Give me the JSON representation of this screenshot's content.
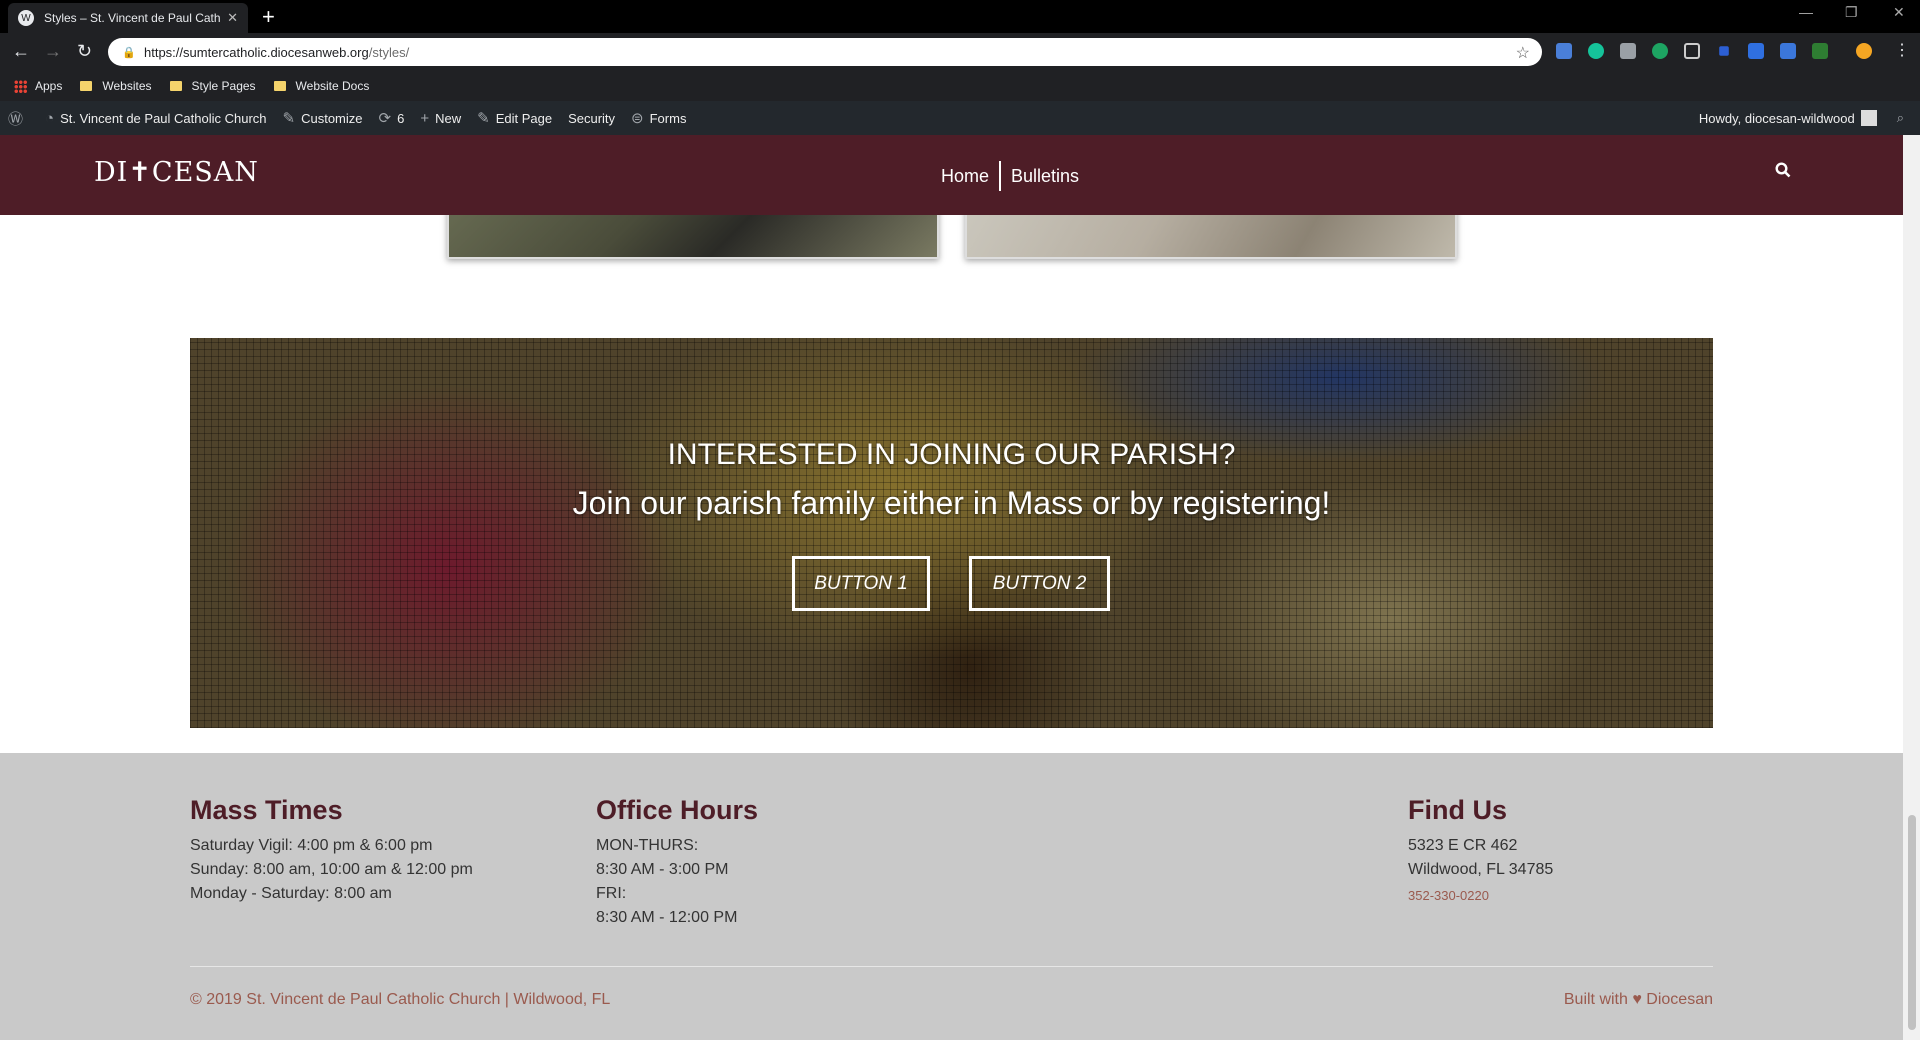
{
  "browser": {
    "tab_title": "Styles – St. Vincent de Paul Catho",
    "url_host": "https://sumtercatholic.diocesanweb.org",
    "url_path": "/styles/",
    "bookmarks": [
      "Apps",
      "Websites",
      "Style Pages",
      "Website Docs"
    ]
  },
  "adminbar": {
    "site_name": "St. Vincent de Paul Catholic Church",
    "customize": "Customize",
    "updates_count": "6",
    "new": "New",
    "edit_page": "Edit Page",
    "security": "Security",
    "forms": "Forms",
    "howdy": "Howdy, diocesan-wildwood"
  },
  "header": {
    "logo": "DI✝CESAN",
    "nav": [
      "Home",
      "Bulletins"
    ]
  },
  "cta": {
    "title": "INTERESTED IN JOINING OUR PARISH?",
    "subtitle": "Join our parish family either in Mass or by registering!",
    "button1": "BUTTON 1",
    "button2": "BUTTON 2"
  },
  "footer": {
    "mass": {
      "heading": "Mass Times",
      "lines": [
        "Saturday Vigil: 4:00 pm & 6:00 pm",
        "Sunday: 8:00 am, 10:00 am & 12:00 pm",
        "Monday - Saturday: 8:00 am"
      ]
    },
    "office": {
      "heading": "Office Hours",
      "lines": [
        "MON-THURS:",
        "8:30 AM - 3:00 PM",
        "FRI:",
        "8:30 AM - 12:00 PM"
      ]
    },
    "find": {
      "heading": "Find Us",
      "lines": [
        "5323 E CR 462",
        "Wildwood, FL 34785"
      ],
      "phone": "352-330-0220"
    },
    "copyright": "© 2019 St. Vincent de Paul Catholic Church | Wildwood, FL",
    "built_with": "Built with ♥ Diocesan"
  },
  "colors": {
    "brand_maroon": "#4e1d27",
    "footer_bg": "#c9c9c9",
    "footer_link": "#9a5a4e"
  }
}
